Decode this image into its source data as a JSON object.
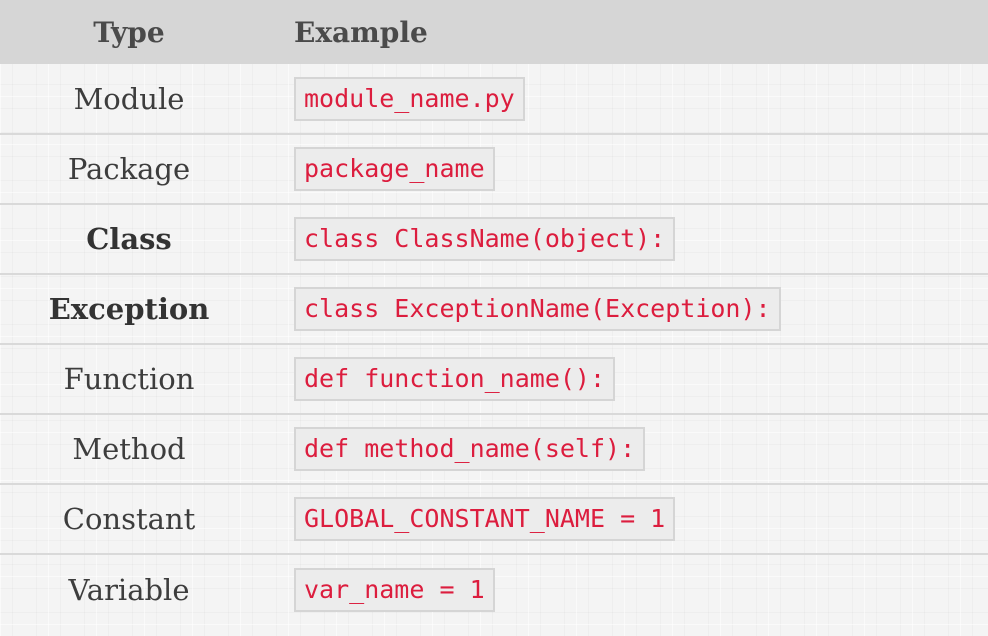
{
  "header": {
    "type_label": "Type",
    "example_label": "Example"
  },
  "rows": [
    {
      "type": "Module",
      "example": "module_name.py",
      "bold": false
    },
    {
      "type": "Package",
      "example": "package_name",
      "bold": false
    },
    {
      "type": "Class",
      "example": "class ClassName(object):",
      "bold": true
    },
    {
      "type": "Exception",
      "example": "class ExceptionName(Exception):",
      "bold": true
    },
    {
      "type": "Function",
      "example": "def function_name():",
      "bold": false
    },
    {
      "type": "Method",
      "example": "def method_name(self):",
      "bold": false
    },
    {
      "type": "Constant",
      "example": "GLOBAL_CONSTANT_NAME = 1",
      "bold": false
    },
    {
      "type": "Variable",
      "example": "var_name = 1",
      "bold": false
    }
  ],
  "colors": {
    "header_background": "#d6d6d6",
    "code_text": "#dc1d3e",
    "code_background": "#ececec",
    "row_divider": "#d9d9d9"
  }
}
